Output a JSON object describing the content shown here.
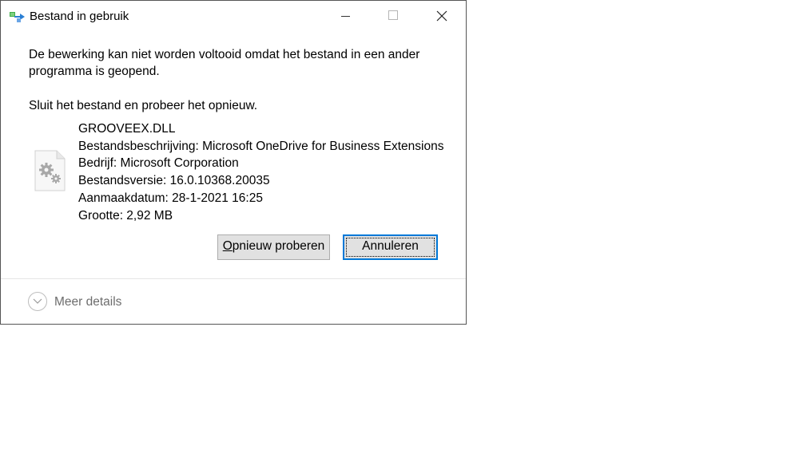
{
  "window": {
    "title": "Bestand in gebruik",
    "title_icon": "file-transfer-icon",
    "controls": [
      "minimize-icon",
      "maximize-icon",
      "close-icon"
    ]
  },
  "message": {
    "line1": "De bewerking kan niet worden voltooid omdat het bestand in een ander programma is geopend.",
    "line2": "Sluit het bestand en probeer het opnieuw."
  },
  "file": {
    "icon": "dll-file-gear-icon",
    "name": "GROOVEEX.DLL",
    "description": "Bestandsbeschrijving: Microsoft OneDrive for Business Extensions",
    "company": "Bedrijf: Microsoft Corporation",
    "version": "Bestandsversie: 16.0.10368.20035",
    "created": "Aanmaakdatum: 28-1-2021 16:25",
    "size": "Grootte: 2,92 MB"
  },
  "buttons": {
    "retry_label_mnemonic": "O",
    "retry_label_rest": "pnieuw proberen",
    "cancel_label": "Annuleren"
  },
  "footer": {
    "more_details_label": "Meer details",
    "expand_icon": "chevron-down-icon"
  }
}
